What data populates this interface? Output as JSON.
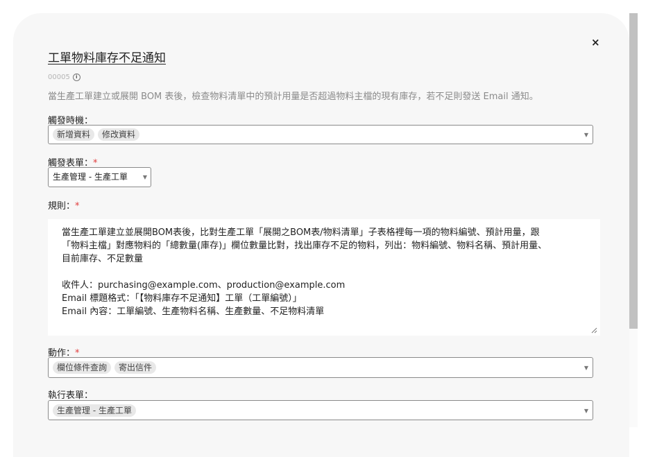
{
  "modal": {
    "close_label": "×",
    "title": "工單物料庫存不足通知",
    "code": "00005",
    "description": "當生產工單建立或展開 BOM 表後，檢查物料清單中的預計用量是否超過物料主檔的現有庫存，若不足則發送 Email 通知。"
  },
  "trigger_timing": {
    "label": "觸發時機：",
    "chips": [
      "新增資料",
      "修改資料"
    ]
  },
  "trigger_form": {
    "label": "觸發表單：",
    "required_mark": "*",
    "value": "生產管理 - 生產工單"
  },
  "rule": {
    "label": "規則：",
    "required_mark": "*",
    "lines": [
      "當生產工單建立並展開BOM表後，比對生產工單「展開之BOM表/物料清單」子表格裡每一項的物料編號、預計用量，跟",
      "「物料主檔」對應物料的「總數量(庫存)」欄位數量比對，找出庫存不足的物料，列出：物料編號、物料名稱、預計用量、",
      "目前庫存、不足數量",
      "",
      "收件人：purchasing@example.com、production@example.com",
      "Email 標題格式：「【物料庫存不足通知】工單（工單編號）」",
      "Email 內容：工單編號、生產物料名稱、生產數量、不足物料清單"
    ]
  },
  "action": {
    "label": "動作：",
    "required_mark": "*",
    "chips": [
      "欄位條件查詢",
      "寄出信件"
    ]
  },
  "exec_form": {
    "label": "執行表單：",
    "chips": [
      "生產管理 - 生產工單"
    ]
  },
  "icons": {
    "info": "info-icon",
    "caret": "caret-down-icon",
    "close": "close-icon",
    "resize": "resize-handle-icon"
  }
}
